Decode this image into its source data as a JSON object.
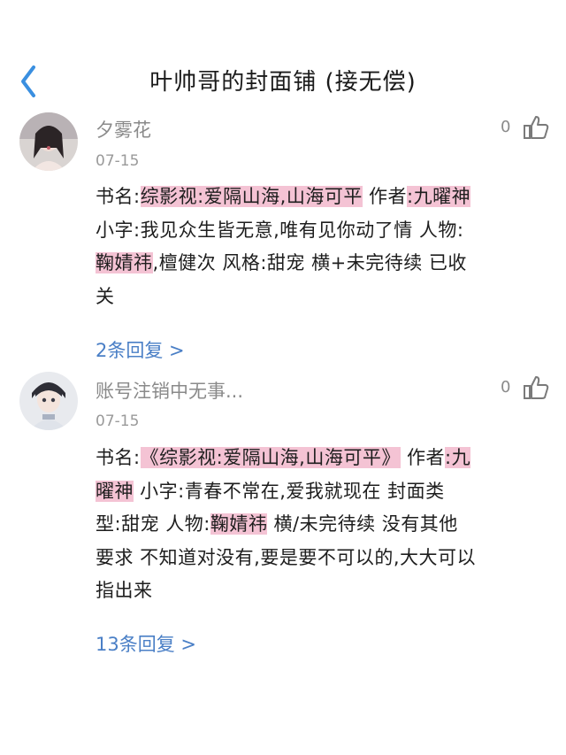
{
  "header": {
    "title": "叶帅哥的封面铺 (接无偿)"
  },
  "comments": [
    {
      "username": "夕雾花",
      "date": "07-15",
      "likes": "0",
      "replies_label": "2条回复 >",
      "lines": [
        [
          "书名:",
          "综影视:爱隔山海,山海可平",
          " 作者",
          ":九曜神"
        ],
        [
          "小字:我见众生皆无意,唯有见你动了情  人物:"
        ],
        [
          "鞠婧祎",
          ",檀健次  风格:甜宠  横+未完待续  已收"
        ],
        [
          "关"
        ]
      ]
    },
    {
      "username": "账号注销中无事...",
      "date": "07-15",
      "likes": "0",
      "replies_label": "13条回复 >",
      "lines": [
        [
          "书名:",
          "《综影视:爱隔山海,山海可平》",
          "  作者",
          ":九"
        ],
        [
          "曜神",
          "  小字:青春不常在,爱我就现在    封面类"
        ],
        [
          "型:甜宠  人物:",
          "鞠婧祎",
          "  横/未完待续  没有其他"
        ],
        [
          "要求  不知道对没有,要是要不可以的,大大可以"
        ],
        [
          "指出来"
        ]
      ]
    }
  ],
  "colors": {
    "highlight": "#f4c3d4",
    "link": "#4a7fc6",
    "back_arrow": "#3a8fe0"
  }
}
